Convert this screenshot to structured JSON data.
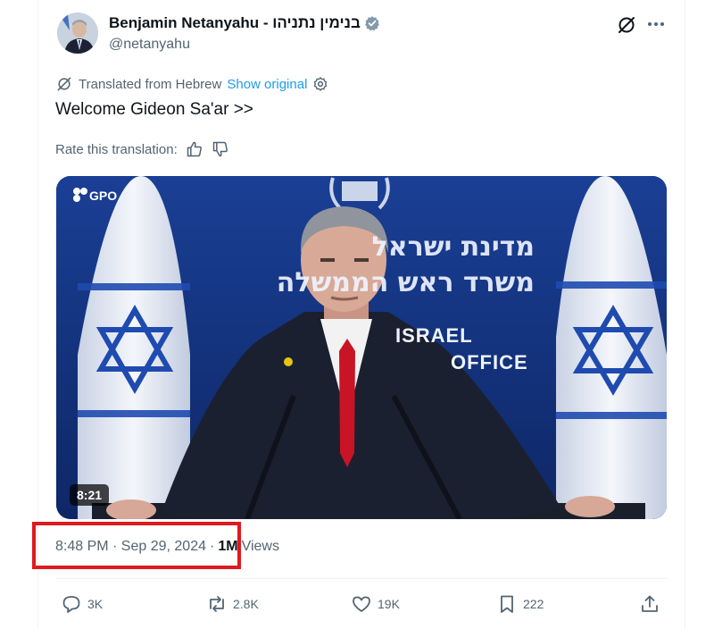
{
  "author": {
    "name": "Benjamin Netanyahu - בנימין נתניהו",
    "handle": "@netanyahu"
  },
  "translation": {
    "label": "Translated from Hebrew",
    "show_original": "Show original"
  },
  "tweet": {
    "text": "Welcome Gideon Sa'ar >>"
  },
  "rate": {
    "label": "Rate this translation:"
  },
  "video": {
    "watermark": "GPO",
    "duration": "8:21",
    "backdrop_text": [
      "מדינת ישראל",
      "משרד ראש הממשלה",
      "ISRAEL",
      "OFFICE"
    ]
  },
  "meta": {
    "timestamp": "8:48 PM · Sep 29, 2024",
    "separator": "·",
    "views_count": "1M",
    "views_label": "Views"
  },
  "actions": {
    "replies": "3K",
    "reposts": "2.8K",
    "likes": "19K",
    "bookmarks": "222"
  },
  "colors": {
    "accent": "#1d9bf0",
    "highlight": "#e0191f",
    "text_secondary": "#536471",
    "video_bg": "#12307a"
  },
  "icons": [
    "grok-icon",
    "more-icon",
    "translate-icon",
    "settings-icon",
    "thumbs-up-icon",
    "thumbs-down-icon",
    "reply-icon",
    "repost-icon",
    "like-icon",
    "bookmark-icon",
    "share-icon",
    "verified-icon"
  ]
}
